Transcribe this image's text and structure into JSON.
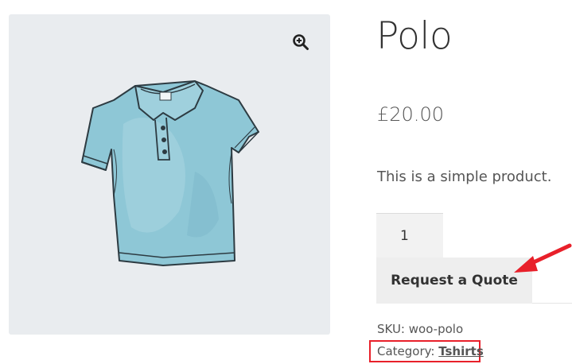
{
  "product": {
    "title": "Polo",
    "price": "£20.00",
    "short_description": "This is a simple product.",
    "quantity": "1",
    "quote_button_label": "Request a Quote",
    "sku_label": "SKU:",
    "sku_value": "woo-polo",
    "category_label": "Category:",
    "category_value": "Tshirts"
  },
  "gallery": {
    "zoom_icon": "zoom-in-icon",
    "image_subject": "light-blue-polo-shirt"
  },
  "annotations": {
    "highlight_color": "#e8202a"
  },
  "colors": {
    "gallery_bg": "#e9ecef",
    "button_bg": "#eeeeee",
    "shirt_fill": "#8ec7d6",
    "shirt_outline": "#2d3b42"
  }
}
